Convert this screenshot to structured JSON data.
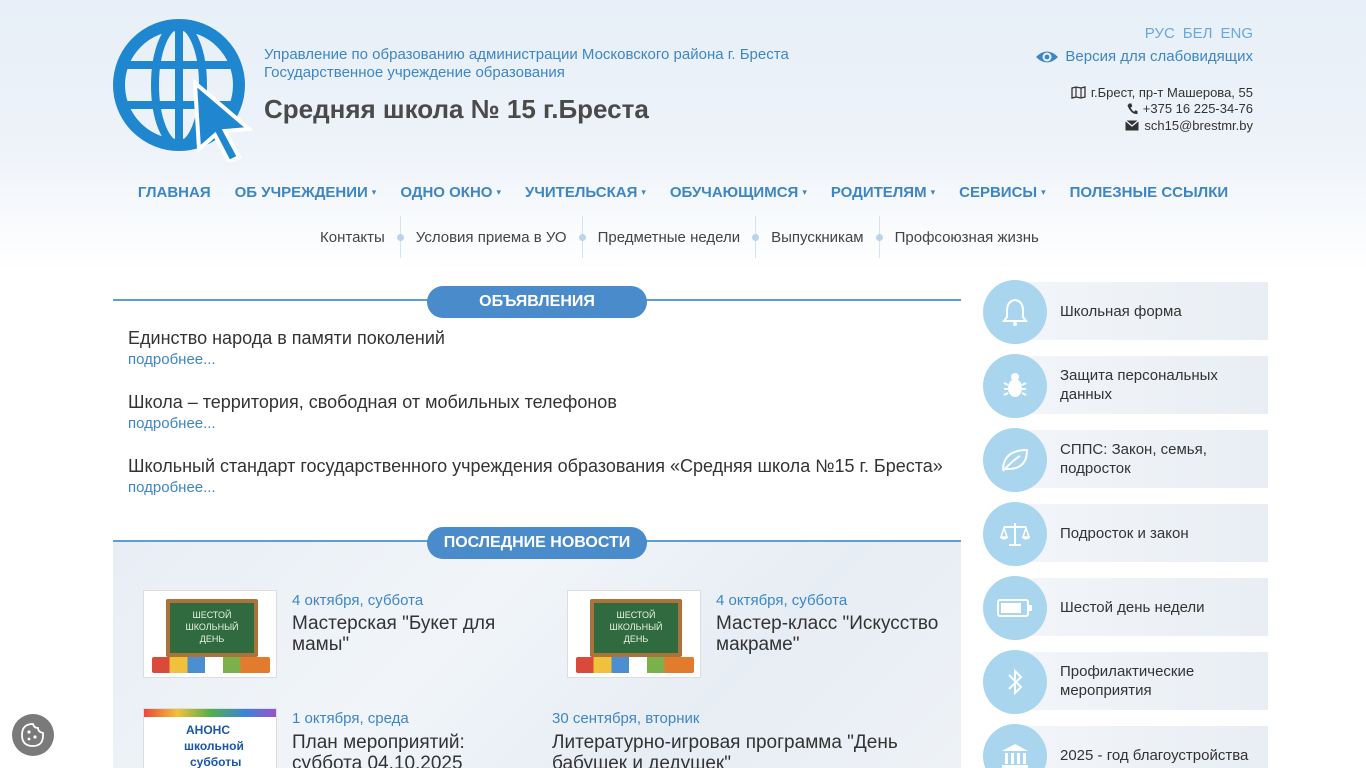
{
  "header": {
    "org_line1": "Управление по образованию администрации Московского района г. Бреста",
    "org_line2": "Государственное учреждение образования",
    "school_title": "Средняя школа № 15 г.Бреста",
    "languages": [
      "РУС",
      "БЕЛ",
      "ENG"
    ],
    "vision_link": "Версия для слабовидящих",
    "address": "г.Брест, пр-т Машерова, 55",
    "phone": "+375 16 225-34-76",
    "email": "sch15@brestmr.by"
  },
  "main_nav": [
    {
      "label": "ГЛАВНАЯ",
      "dropdown": false
    },
    {
      "label": "ОБ УЧРЕЖДЕНИИ",
      "dropdown": true
    },
    {
      "label": "ОДНО ОКНО",
      "dropdown": true
    },
    {
      "label": "УЧИТЕЛЬСКАЯ",
      "dropdown": true
    },
    {
      "label": "ОБУЧАЮЩИМСЯ",
      "dropdown": true
    },
    {
      "label": "РОДИТЕЛЯМ",
      "dropdown": true
    },
    {
      "label": "СЕРВИСЫ",
      "dropdown": true
    },
    {
      "label": "ПОЛЕЗНЫЕ ССЫЛКИ",
      "dropdown": false
    }
  ],
  "caret": "▾",
  "sub_nav": [
    "Контакты",
    "Условия приема в УО",
    "Предметные недели",
    "Выпускникам",
    "Профсоюзная жизнь"
  ],
  "announcements": {
    "heading": "ОБЪЯВЛЕНИЯ",
    "items": [
      {
        "title": "Единство народа в памяти поколений",
        "more": "подробнее..."
      },
      {
        "title": "Школа – территория, свободная от мобильных телефонов",
        "more": "подробнее..."
      },
      {
        "title": "Школьный стандарт государственного учреждения образования «Средняя школа №15 г. Бреста»",
        "more": "подробнее..."
      }
    ]
  },
  "news": {
    "heading": "ПОСЛЕДНИЕ НОВОСТИ",
    "items": [
      {
        "date": "4 октября, суббота",
        "title": "Мастерская \"Букет для мамы\""
      },
      {
        "date": "4 октября, суббота",
        "title": "Мастер-класс \"Искусство макраме\""
      },
      {
        "date": "1 октября, среда",
        "title": "План мероприятий: суббота 04.10.2025"
      },
      {
        "date": "30 сентября, вторник",
        "title": "Литературно-игровая программа \"День бабушек и дедушек\""
      }
    ],
    "image_board_text": [
      "ШЕСТОЙ",
      "ШКОЛЬНЫЙ",
      "ДЕНЬ"
    ],
    "anons_text": [
      "АНОНС",
      "школьной",
      "субботы"
    ]
  },
  "sidebar": [
    {
      "label": "Школьная форма",
      "icon": "bell-icon"
    },
    {
      "label": "Защита персональных данных",
      "icon": "bug-icon"
    },
    {
      "label": "СППС: Закон, семья, подросток",
      "icon": "leaf-icon"
    },
    {
      "label": "Подросток и закон",
      "icon": "scales-icon"
    },
    {
      "label": "Шестой день недели",
      "icon": "battery-icon"
    },
    {
      "label": "Профилактические мероприятия",
      "icon": "bluetooth-icon"
    },
    {
      "label": "2025 - год благоустройства",
      "icon": "bank-icon"
    }
  ],
  "colors": {
    "accent": "#3d86c6",
    "pill": "#4a8ccb",
    "sidebar_circle": "#a9d6ee"
  }
}
